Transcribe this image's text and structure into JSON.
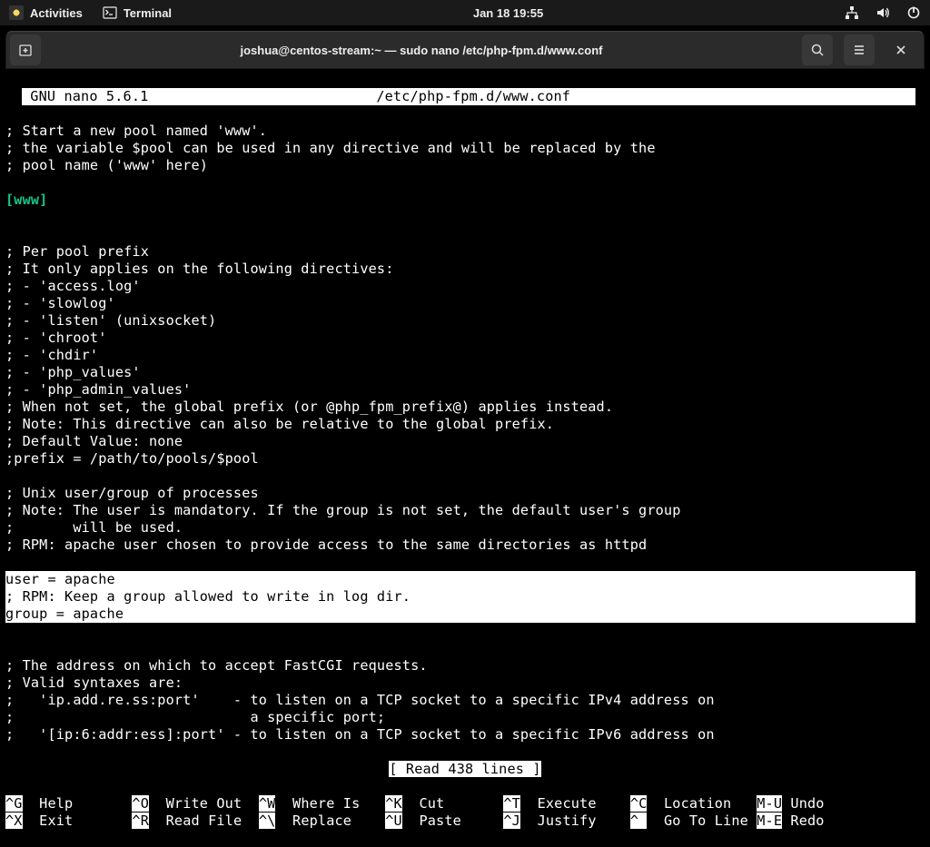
{
  "topbar": {
    "activities": "Activities",
    "terminal": "Terminal",
    "datetime": "Jan 18  19:55"
  },
  "titlebar": {
    "title": "joshua@centos-stream:~ — sudo nano /etc/php-fpm.d/www.conf"
  },
  "nano": {
    "header_left": " GNU nano 5.6.1",
    "header_right": "/etc/php-fpm.d/www.conf",
    "body1": "; Start a new pool named 'www'.\n; the variable $pool can be used in any directive and will be replaced by the\n; pool name ('www' here)",
    "section": "[www]",
    "body2": "\n; Per pool prefix\n; It only applies on the following directives:\n; - 'access.log'\n; - 'slowlog'\n; - 'listen' (unixsocket)\n; - 'chroot'\n; - 'chdir'\n; - 'php_values'\n; - 'php_admin_values'\n; When not set, the global prefix (or @php_fpm_prefix@) applies instead.\n; Note: This directive can also be relative to the global prefix.\n; Default Value: none\n;prefix = /path/to/pools/$pool\n\n; Unix user/group of processes\n; Note: The user is mandatory. If the group is not set, the default user's group\n;       will be used.\n; RPM: apache user chosen to provide access to the same directories as httpd",
    "highlight": "user = apache\n; RPM: Keep a group allowed to write in log dir.\ngroup = apache",
    "body3": "\n; The address on which to accept FastCGI requests.\n; Valid syntaxes are:\n;   'ip.add.re.ss:port'    - to listen on a TCP socket to a specific IPv4 address on\n;                            a specific port;\n;   '[ip:6:addr:ess]:port' - to listen on a TCP socket to a specific IPv6 address on",
    "status": "[ Read 438 lines ]",
    "shortcuts": [
      [
        {
          "k": "^G",
          "l": "Help"
        },
        {
          "k": "^X",
          "l": "Exit"
        }
      ],
      [
        {
          "k": "^O",
          "l": "Write Out"
        },
        {
          "k": "^R",
          "l": "Read File"
        }
      ],
      [
        {
          "k": "^W",
          "l": "Where Is"
        },
        {
          "k": "^\\",
          "l": "Replace"
        }
      ],
      [
        {
          "k": "^K",
          "l": "Cut"
        },
        {
          "k": "^U",
          "l": "Paste"
        }
      ],
      [
        {
          "k": "^T",
          "l": "Execute"
        },
        {
          "k": "^J",
          "l": "Justify"
        }
      ],
      [
        {
          "k": "^C",
          "l": "Location"
        },
        {
          "k": "^ ",
          "l": "Go To Line"
        }
      ],
      [
        {
          "k": "M-U",
          "l": "Undo"
        },
        {
          "k": "M-E",
          "l": "Redo"
        }
      ]
    ]
  }
}
